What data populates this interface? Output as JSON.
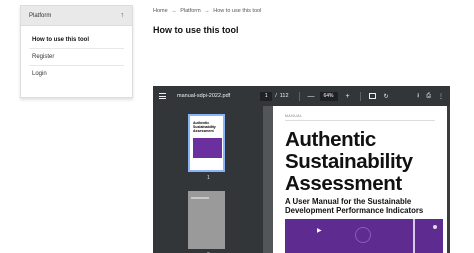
{
  "sidebar": {
    "header": "Platform",
    "toggle_icon": "arrow-up-icon",
    "items": [
      {
        "label": "How to use this tool"
      },
      {
        "label": "Register"
      },
      {
        "label": "Login"
      }
    ]
  },
  "breadcrumb": {
    "items": [
      "Home",
      "Platform",
      "How to use this tool"
    ],
    "separator": "→"
  },
  "page": {
    "title": "How to use this tool"
  },
  "pdf_viewer": {
    "file_name": "manual-sdpi-2022.pdf",
    "current_page": "1",
    "page_sep": "/",
    "total_pages": "112",
    "zoom": "64%",
    "minus": "—",
    "plus": "+",
    "rotate_icon": "↻",
    "download_icon": "⭳",
    "print_icon": "⎙",
    "more_icon": "⋮",
    "thumbnails": [
      {
        "number": "1",
        "title": "Authentic Sustainability Assessment"
      },
      {
        "number": "2"
      }
    ],
    "document": {
      "label": "MANUAL",
      "title_lines": [
        "Authentic",
        "Sustainability",
        "Assessment"
      ],
      "subtitle_lines": [
        "A User Manual for the Sustainable",
        "Development Performance Indicators"
      ],
      "play_icon": "▶"
    }
  },
  "colors": {
    "toolbar": "#323639",
    "viewer_bg": "#525659",
    "accent_purple": "#5e2b91",
    "thumb_selected": "#8ab4f8"
  }
}
